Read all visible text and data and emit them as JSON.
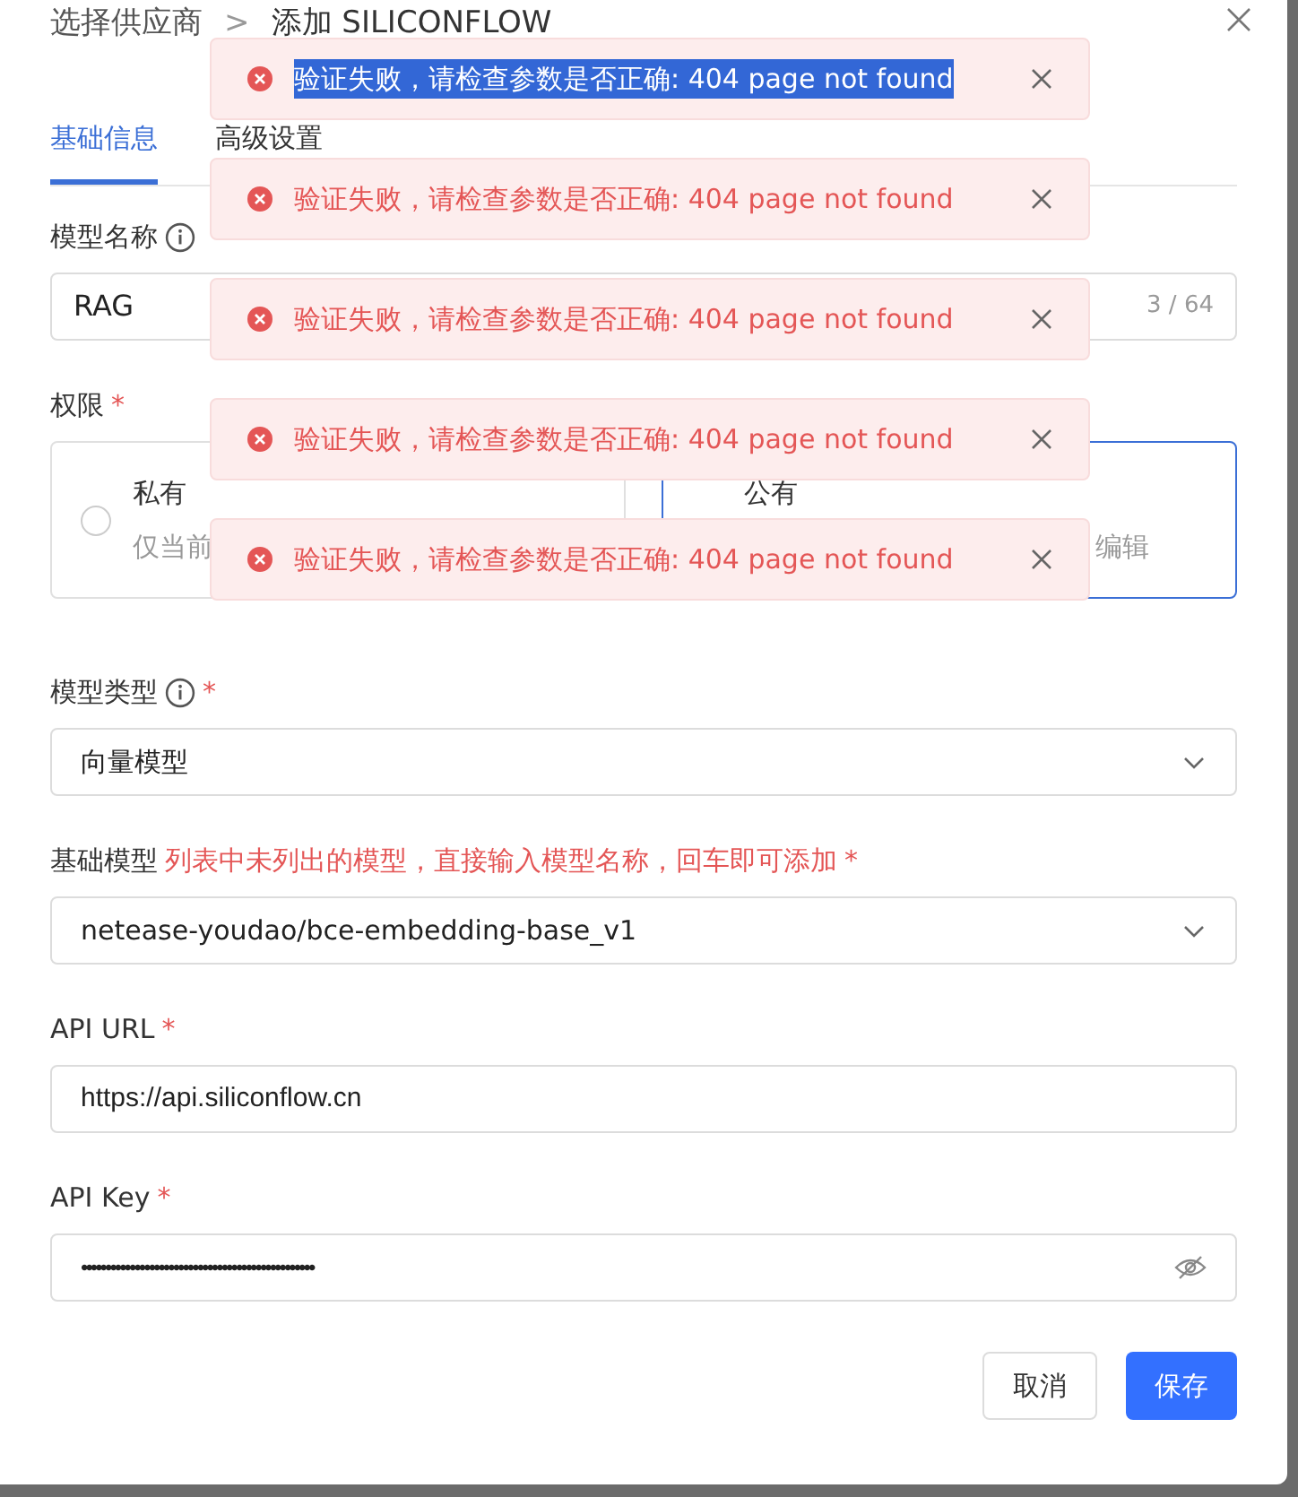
{
  "breadcrumb": {
    "parent": "选择供应商",
    "separator": ">",
    "current": "添加 SILICONFLOW"
  },
  "tabs": [
    {
      "label": "基础信息",
      "selected": true
    },
    {
      "label": "高级设置",
      "selected": false
    }
  ],
  "model_name": {
    "label": "模型名称",
    "value": "RAG",
    "counter": "3 / 64"
  },
  "permission": {
    "label": "权限",
    "required": "*",
    "options": [
      {
        "title": "私有",
        "description": "仅当前",
        "selected": false
      },
      {
        "title": "公有",
        "description": "编辑",
        "selected": true
      }
    ]
  },
  "model_type": {
    "label": "模型类型",
    "required": "*",
    "value": "向量模型"
  },
  "base_model": {
    "label": "基础模型",
    "hint": "列表中未列出的模型，直接输入模型名称，回车即可添加",
    "required": "*",
    "value": "netease-youdao/bce-embedding-base_v1"
  },
  "api_url": {
    "label": "API URL",
    "required": "*",
    "value": "https://api.siliconflow.cn"
  },
  "api_key": {
    "label": "API Key",
    "required": "*",
    "value": "••••••••••••••••••••••••••••••••••••••••••••••••"
  },
  "buttons": {
    "cancel": "取消",
    "save": "保存"
  },
  "toasts": [
    {
      "text": "验证失败，请检查参数是否正确: 404 page not found",
      "highlighted": true
    },
    {
      "text": "验证失败，请检查参数是否正确: 404 page not found",
      "highlighted": false
    },
    {
      "text": "验证失败，请检查参数是否正确: 404 page not found",
      "highlighted": false
    },
    {
      "text": "验证失败，请检查参数是否正确: 404 page not found",
      "highlighted": false
    },
    {
      "text": "验证失败，请检查参数是否正确: 404 page not found",
      "highlighted": false
    }
  ]
}
